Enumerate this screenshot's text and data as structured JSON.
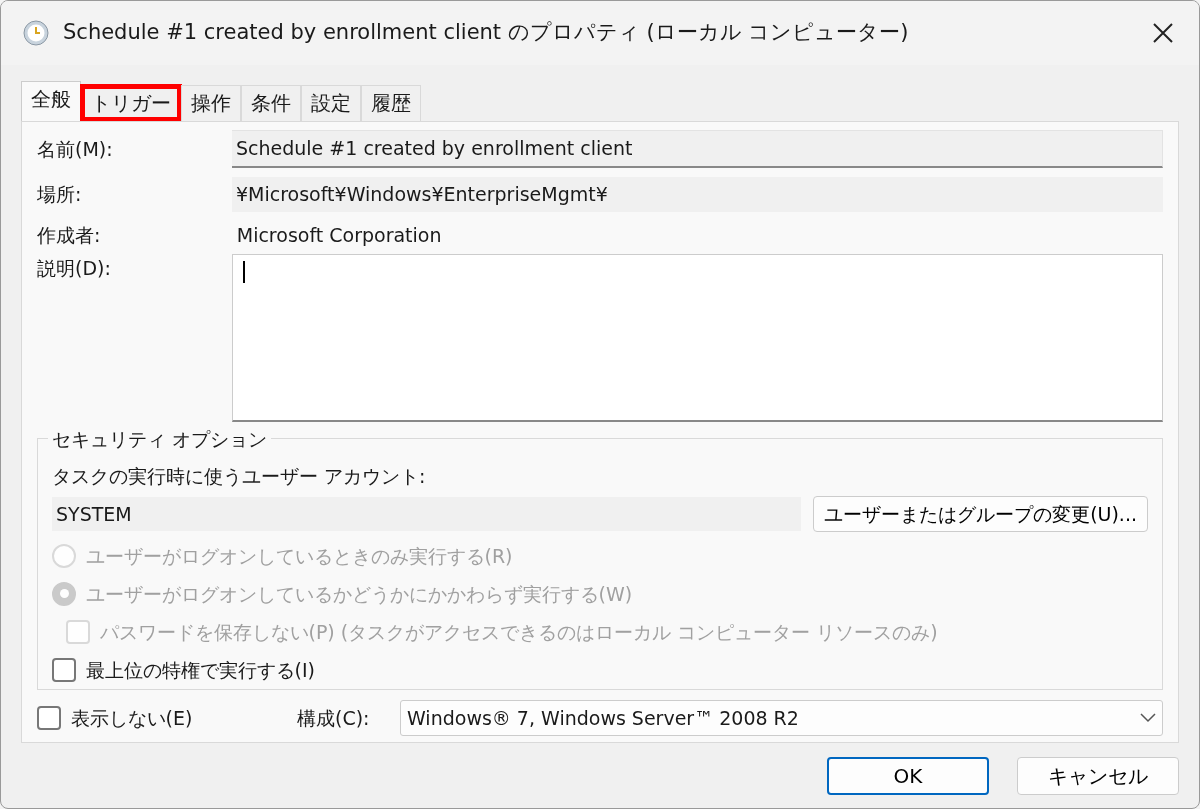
{
  "window": {
    "title": "Schedule #1 created by enrollment client のプロパティ (ローカル コンピューター)"
  },
  "tabs": [
    {
      "label": "全般",
      "selected": true,
      "highlighted": false
    },
    {
      "label": "トリガー",
      "selected": false,
      "highlighted": true
    },
    {
      "label": "操作",
      "selected": false,
      "highlighted": false
    },
    {
      "label": "条件",
      "selected": false,
      "highlighted": false
    },
    {
      "label": "設定",
      "selected": false,
      "highlighted": false
    },
    {
      "label": "履歴",
      "selected": false,
      "highlighted": false
    }
  ],
  "general": {
    "name": {
      "label": "名前(M):",
      "value": "Schedule #1  created by enrollment client"
    },
    "location": {
      "label": "場所:",
      "value": "¥Microsoft¥Windows¥EnterpriseMgmt¥"
    },
    "author": {
      "label": "作成者:",
      "value": "Microsoft Corporation"
    },
    "description": {
      "label": "説明(D):"
    }
  },
  "security": {
    "title": "セキュリティ オプション",
    "account_label": "タスクの実行時に使うユーザー アカウント:",
    "account_value": "SYSTEM",
    "change_button": "ユーザーまたはグループの変更(U)...",
    "options": [
      {
        "kind": "radio",
        "label": "ユーザーがログオンしているときのみ実行する(R)",
        "selected": false,
        "disabled": true
      },
      {
        "kind": "radio",
        "label": "ユーザーがログオンしているかどうかにかかわらず実行する(W)",
        "selected": true,
        "disabled": true,
        "children": [
          {
            "kind": "checkbox",
            "label": "パスワードを保存しない(P) (タスクがアクセスできるのはローカル コンピューター リソースのみ)",
            "checked": false,
            "disabled": true
          }
        ]
      },
      {
        "kind": "checkbox",
        "label": "最上位の特権で実行する(I)",
        "checked": false,
        "disabled": false
      }
    ]
  },
  "hidden": {
    "label": "表示しない(E)",
    "checked": false
  },
  "configure": {
    "label": "構成(C):",
    "value": "Windows® 7, Windows Server™ 2008 R2"
  },
  "buttons": [
    {
      "label": "OK",
      "default": true
    },
    {
      "label": "キャンセル",
      "default": false
    }
  ]
}
